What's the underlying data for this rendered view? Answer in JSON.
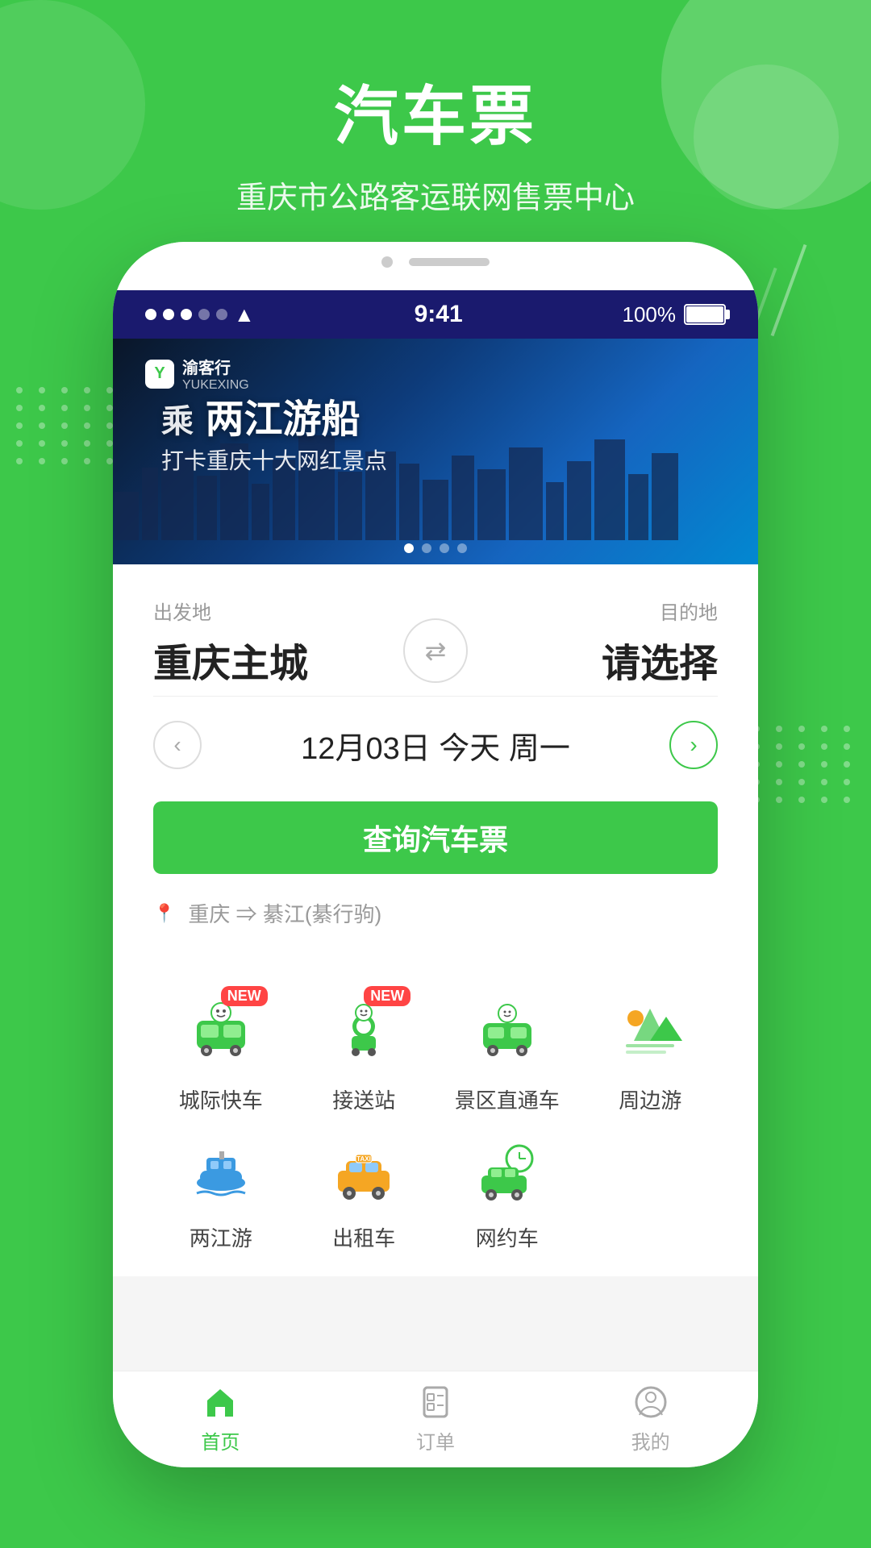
{
  "app": {
    "title": "汽车票",
    "subtitle": "重庆市公路客运联网售票中心"
  },
  "status_bar": {
    "time": "9:41",
    "battery": "100%"
  },
  "banner": {
    "logo": "渝客行",
    "logo_en": "YUKEXING",
    "text_main": "乘 两江游船",
    "text_sub": "打卡重庆十大网红景点",
    "dots": [
      true,
      false,
      false,
      false
    ]
  },
  "booking": {
    "from_label": "出发地",
    "to_label": "目的地",
    "from_city": "重庆主城",
    "to_placeholder": "请选择",
    "date": "12月03日 今天 周一",
    "search_btn": "查询汽车票",
    "recent": "重庆 ⇒ 綦江(綦行驹)"
  },
  "services": {
    "row1": [
      {
        "label": "城际快车",
        "new": true,
        "icon": "bus"
      },
      {
        "label": "接送站",
        "new": true,
        "icon": "station"
      },
      {
        "label": "景区直通车",
        "new": false,
        "icon": "scenic"
      },
      {
        "label": "周边游",
        "new": false,
        "icon": "mountain"
      }
    ],
    "row2": [
      {
        "label": "两江游",
        "new": false,
        "icon": "boat"
      },
      {
        "label": "出租车",
        "new": false,
        "icon": "taxi"
      },
      {
        "label": "网约车",
        "new": false,
        "icon": "rideshare"
      }
    ]
  },
  "tabs": [
    {
      "label": "首页",
      "active": true,
      "icon": "home"
    },
    {
      "label": "订单",
      "active": false,
      "icon": "order"
    },
    {
      "label": "我的",
      "active": false,
      "icon": "profile"
    }
  ],
  "colors": {
    "green": "#3dc84a",
    "dark": "#222",
    "gray": "#999"
  }
}
